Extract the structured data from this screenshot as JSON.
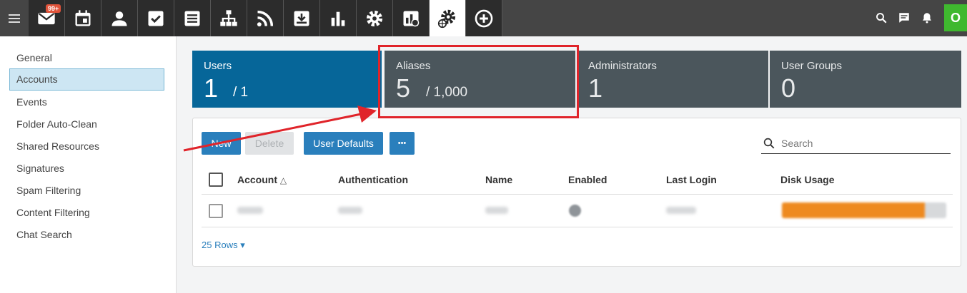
{
  "topbar": {
    "mail_badge": "99+",
    "icons": [
      "mail-icon",
      "calendar-icon",
      "contacts-icon",
      "tasks-icon",
      "notes-icon",
      "sitemap-icon",
      "rss-icon",
      "download-icon",
      "reports-icon",
      "settings-icon",
      "domain-reports-icon",
      "domain-settings-icon",
      "add-icon"
    ],
    "right_icons": [
      "search-icon",
      "chat-icon",
      "bell-icon"
    ],
    "avatar_initial": "O",
    "avatar_color": "#3fb82f"
  },
  "sidebar": {
    "items": [
      {
        "label": "General"
      },
      {
        "label": "Accounts",
        "active": true
      },
      {
        "label": "Events"
      },
      {
        "label": "Folder Auto-Clean"
      },
      {
        "label": "Shared Resources"
      },
      {
        "label": "Signatures"
      },
      {
        "label": "Spam Filtering"
      },
      {
        "label": "Content Filtering"
      },
      {
        "label": "Chat Search"
      }
    ]
  },
  "cards": [
    {
      "label": "Users",
      "value": "1",
      "limit": "/ 1",
      "active": true
    },
    {
      "label": "Aliases",
      "value": "5",
      "limit": "/ 1,000"
    },
    {
      "label": "Administrators",
      "value": "1"
    },
    {
      "label": "User Groups",
      "value": "0"
    }
  ],
  "toolbar": {
    "new_label": "New",
    "delete_label": "Delete",
    "user_defaults_label": "User Defaults",
    "more_label": "•••"
  },
  "search": {
    "placeholder": "Search"
  },
  "table": {
    "headers": [
      "Account",
      "Authentication",
      "Name",
      "Enabled",
      "Last Login",
      "Disk Usage"
    ],
    "sort_indicator": "△"
  },
  "pagination": {
    "rows_label": "25 Rows ▾"
  },
  "colors": {
    "topbar": "#454545",
    "active_card": "#066699",
    "card": "#4b565c",
    "button": "#2a7fbc",
    "highlight": "#e0242a",
    "disk_fill": "#ee8a1f"
  }
}
